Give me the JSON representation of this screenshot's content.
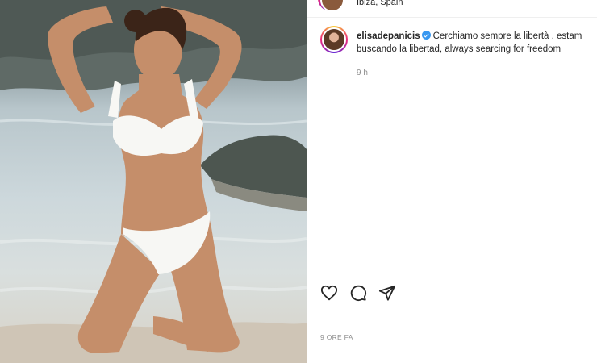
{
  "post": {
    "location": "Ibiza, Spain",
    "caption": {
      "username": "elisadepanicis",
      "line1": "Cerchiamo sempre la libertà , estam",
      "line2": "buscando la libertad, always searcing for freedom",
      "time": "9 h"
    },
    "actions": {
      "like_icon": "heart-icon",
      "comment_icon": "comment-icon",
      "share_icon": "share-icon"
    },
    "date": "9 ORE FA"
  },
  "colors": {
    "verified": "#3897f0",
    "text_primary": "#262626",
    "text_secondary": "#8e8e8e",
    "divider": "#efefef"
  }
}
